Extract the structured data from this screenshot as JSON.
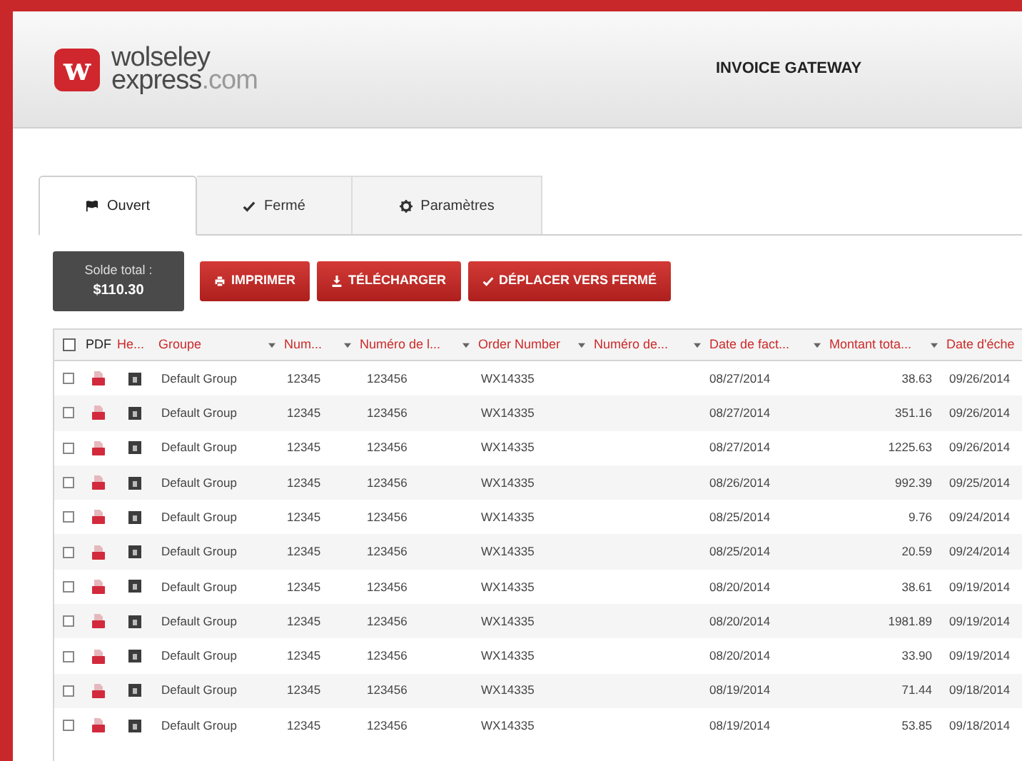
{
  "header": {
    "logo": {
      "mark": "w",
      "line1": "wolseley",
      "line2": "express",
      "suffix": ".com"
    },
    "title": "INVOICE GATEWAY"
  },
  "tabs": [
    {
      "label": "Ouvert",
      "kind": "flag",
      "selected": true
    },
    {
      "label": "Fermé",
      "kind": "check",
      "selected": false
    },
    {
      "label": "Paramètres",
      "kind": "gear",
      "selected": false
    }
  ],
  "balance": {
    "label": "Solde total :",
    "value": "$110.30"
  },
  "actions": [
    {
      "label": "IMPRIMER",
      "kind": "print"
    },
    {
      "label": "TÉLÉCHARGER",
      "kind": "download"
    },
    {
      "label": "DÉPLACER VERS FERMÉ",
      "kind": "check"
    }
  ],
  "table": {
    "select_all": {
      "checked": false
    },
    "columns": [
      {
        "label": "PDF",
        "kind": "plain",
        "sort_arrow": false
      },
      {
        "label": "He...",
        "kind": "link",
        "sort_arrow": false
      },
      {
        "label": "Groupe",
        "kind": "link",
        "sort_arrow": true
      },
      {
        "label": "Num...",
        "kind": "link",
        "sort_arrow": true
      },
      {
        "label": "Numéro de l...",
        "kind": "link",
        "sort_arrow": true
      },
      {
        "label": "Order Number",
        "kind": "link",
        "sort_arrow": true
      },
      {
        "label": "Numéro de...",
        "kind": "link",
        "sort_arrow": true
      },
      {
        "label": "Date de fact...",
        "kind": "link",
        "sort_arrow": true
      },
      {
        "label": "Montant tota...",
        "kind": "link",
        "sort_arrow": true
      },
      {
        "label": "Date d'éche",
        "kind": "link",
        "sort_arrow": false
      }
    ],
    "rows": [
      {
        "checked": false,
        "group": "Default Group",
        "num": "12345",
        "number": "123456",
        "order_number": "WX14335",
        "invoice_date": "08/27/2014",
        "amount": "38.63",
        "due_date": "09/26/2014"
      },
      {
        "checked": false,
        "group": "Default Group",
        "num": "12345",
        "number": "123456",
        "order_number": "WX14335",
        "invoice_date": "08/27/2014",
        "amount": "351.16",
        "due_date": "09/26/2014"
      },
      {
        "checked": false,
        "group": "Default Group",
        "num": "12345",
        "number": "123456",
        "order_number": "WX14335",
        "invoice_date": "08/27/2014",
        "amount": "1225.63",
        "due_date": "09/26/2014"
      },
      {
        "checked": false,
        "group": "Default Group",
        "num": "12345",
        "number": "123456",
        "order_number": "WX14335",
        "invoice_date": "08/26/2014",
        "amount": "992.39",
        "due_date": "09/25/2014"
      },
      {
        "checked": false,
        "group": "Default Group",
        "num": "12345",
        "number": "123456",
        "order_number": "WX14335",
        "invoice_date": "08/25/2014",
        "amount": "9.76",
        "due_date": "09/24/2014"
      },
      {
        "checked": false,
        "group": "Default Group",
        "num": "12345",
        "number": "123456",
        "order_number": "WX14335",
        "invoice_date": "08/25/2014",
        "amount": "20.59",
        "due_date": "09/24/2014"
      },
      {
        "checked": false,
        "group": "Default Group",
        "num": "12345",
        "number": "123456",
        "order_number": "WX14335",
        "invoice_date": "08/20/2014",
        "amount": "38.61",
        "due_date": "09/19/2014"
      },
      {
        "checked": false,
        "group": "Default Group",
        "num": "12345",
        "number": "123456",
        "order_number": "WX14335",
        "invoice_date": "08/20/2014",
        "amount": "1981.89",
        "due_date": "09/19/2014"
      },
      {
        "checked": false,
        "group": "Default Group",
        "num": "12345",
        "number": "123456",
        "order_number": "WX14335",
        "invoice_date": "08/20/2014",
        "amount": "33.90",
        "due_date": "09/19/2014"
      },
      {
        "checked": false,
        "group": "Default Group",
        "num": "12345",
        "number": "123456",
        "order_number": "WX14335",
        "invoice_date": "08/19/2014",
        "amount": "71.44",
        "due_date": "09/18/2014"
      },
      {
        "checked": false,
        "group": "Default Group",
        "num": "12345",
        "number": "123456",
        "order_number": "WX14335",
        "invoice_date": "08/19/2014",
        "amount": "53.85",
        "due_date": "09/18/2014"
      }
    ]
  }
}
